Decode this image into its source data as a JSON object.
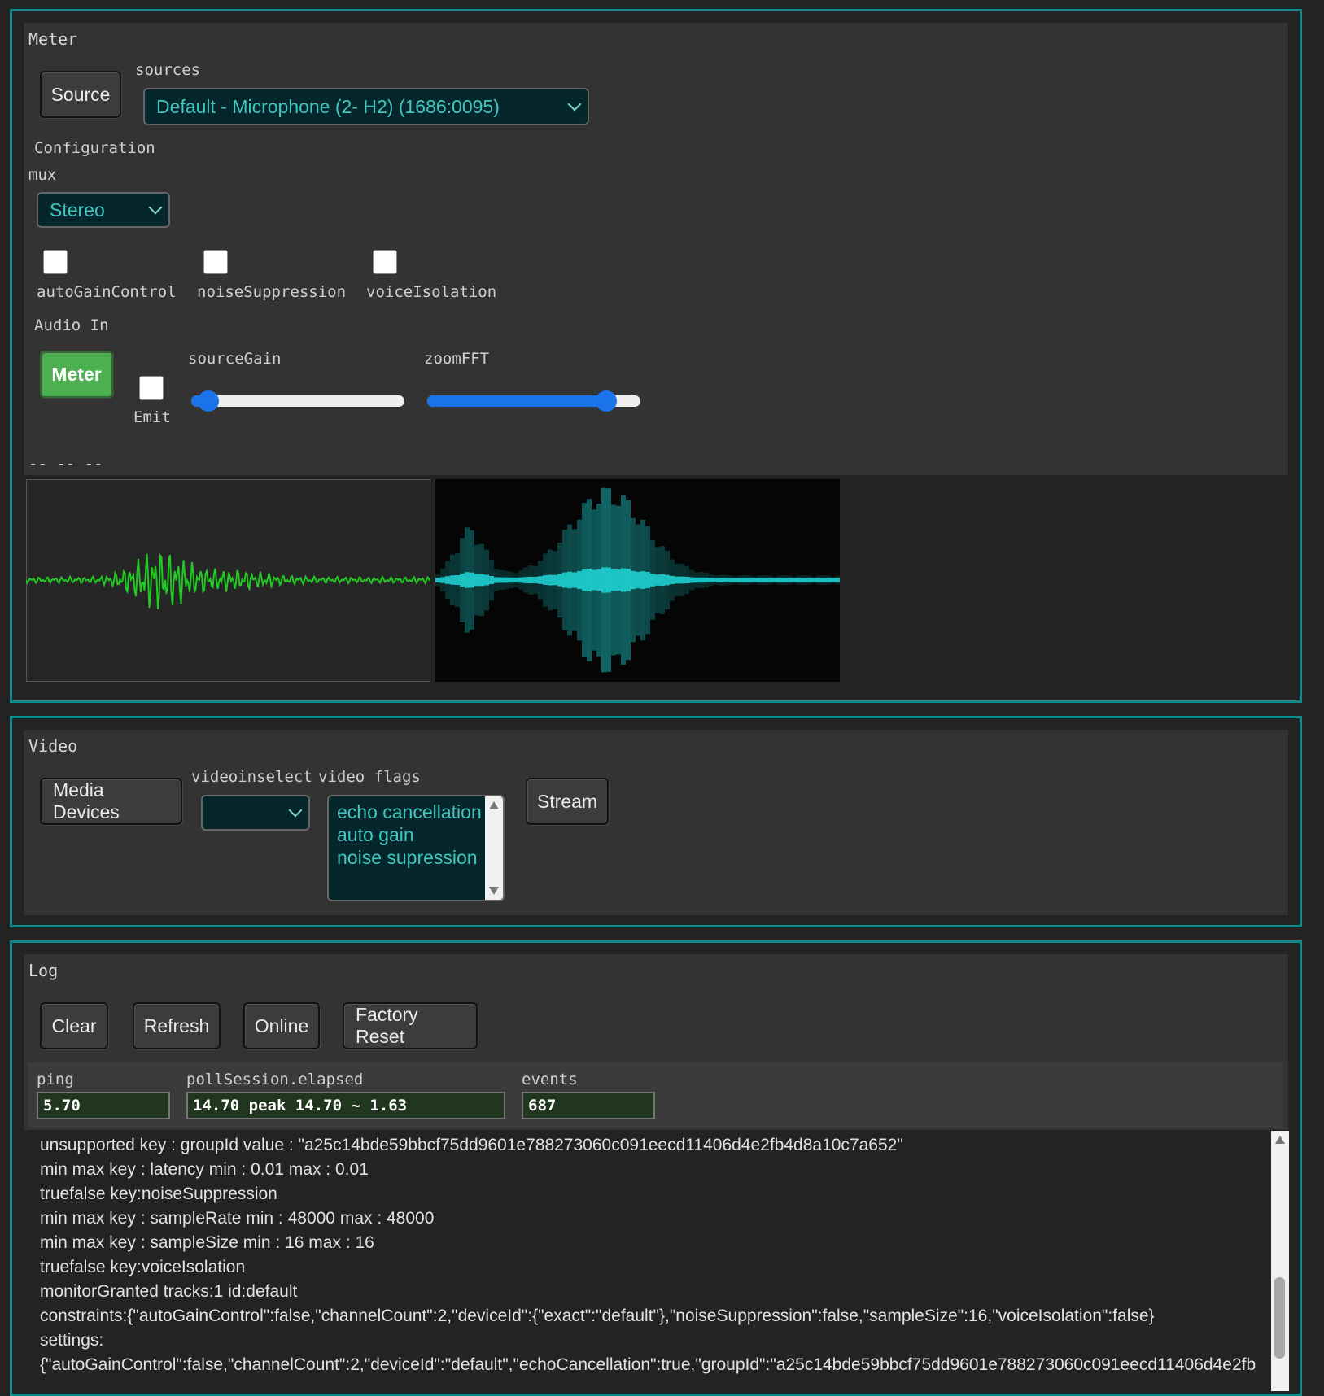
{
  "meter": {
    "title": "Meter",
    "source_button": "Source",
    "sources_label": "sources",
    "sources_value": "Default - Microphone (2- H2) (1686:0095)",
    "configuration_label": "Configuration",
    "mux_label": "mux",
    "mux_value": "Stereo",
    "checkboxes": [
      {
        "label": "autoGainControl",
        "checked": false
      },
      {
        "label": "noiseSuppression",
        "checked": false
      },
      {
        "label": "voiceIsolation",
        "checked": false
      }
    ],
    "audio_in_label": "Audio In",
    "meter_button": "Meter",
    "emit_label": "Emit",
    "emit_checked": false,
    "source_gain_label": "sourceGain",
    "source_gain_value": 0.08,
    "zoom_fft_label": "zoomFFT",
    "zoom_fft_value": 0.84,
    "status_text": "-- -- --",
    "colors": {
      "waveform": "#22c922",
      "spectrum": "#1fd0d0",
      "meter_button": "#4caf50"
    }
  },
  "video": {
    "title": "Video",
    "media_devices_button": "Media Devices",
    "videoinselect_label": "videoinselect",
    "video_flags_label": "video flags",
    "videoinselect_value": "",
    "flags_options": [
      "echo cancellation",
      "auto gain",
      "noise supression"
    ],
    "stream_button": "Stream"
  },
  "log": {
    "title": "Log",
    "buttons": [
      "Clear",
      "Refresh",
      "Online",
      "Factory Reset"
    ],
    "ping_label": "ping",
    "ping_value": "5.70",
    "poll_label": "pollSession.elapsed",
    "poll_value": "14.70 peak 14.70 ~ 1.63",
    "events_label": "events",
    "events_value": "687",
    "lines": [
      "unsupported key : groupId value : \"a25c14bde59bbcf75dd9601e788273060c091eecd11406d4e2fb4d8a10c7a652\"",
      "min max key : latency min : 0.01 max : 0.01",
      "truefalse key:noiseSuppression",
      "min max key : sampleRate min : 48000 max : 48000",
      "min max key : sampleSize min : 16 max : 16",
      "truefalse key:voiceIsolation",
      "monitorGranted tracks:1 id:default",
      "constraints:{\"autoGainControl\":false,\"channelCount\":2,\"deviceId\":{\"exact\":\"default\"},\"noiseSuppression\":false,\"sampleSize\":16,\"voiceIsolation\":false}",
      "settings:",
      "{\"autoGainControl\":false,\"channelCount\":2,\"deviceId\":\"default\",\"echoCancellation\":true,\"groupId\":\"a25c14bde59bbcf75dd9601e788273060c091eecd11406d4e2fb"
    ]
  }
}
